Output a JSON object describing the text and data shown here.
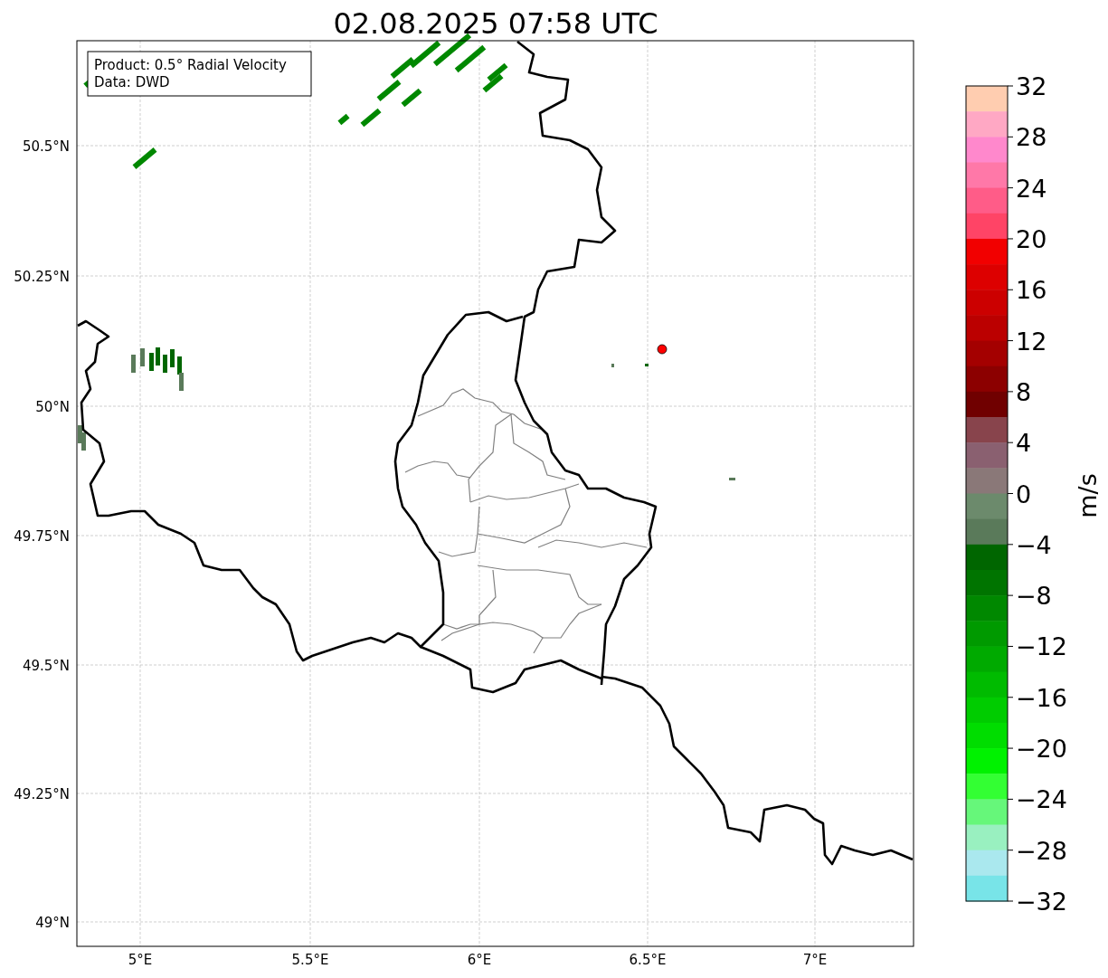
{
  "title": "02.08.2025 07:58 UTC",
  "legend": {
    "lines": [
      "Product: 0.5° Radial Velocity",
      "Data: DWD"
    ]
  },
  "map": {
    "lat_ticks": [
      "50.5°N",
      "50.25°N",
      "50°N",
      "49.75°N",
      "49.5°N",
      "49.25°N",
      "49°N"
    ],
    "lon_ticks": [
      "5°E",
      "5.5°E",
      "6°E",
      "6.5°E",
      "7°E"
    ]
  },
  "colorbar": {
    "label": "m/s",
    "ticks": [
      "32",
      "28",
      "24",
      "20",
      "16",
      "12",
      "8",
      "4",
      "0",
      "−4",
      "−8",
      "−12",
      "−16",
      "−20",
      "−24",
      "−28",
      "−32"
    ],
    "segments": [
      {
        "color": "#ffcdb0"
      },
      {
        "color": "#ffa8c4"
      },
      {
        "color": "#ff88cc"
      },
      {
        "color": "#ff78a8"
      },
      {
        "color": "#ff5c88"
      },
      {
        "color": "#ff4466"
      },
      {
        "color": "#f20000"
      },
      {
        "color": "#dd0000"
      },
      {
        "color": "#cc0000"
      },
      {
        "color": "#bb0000"
      },
      {
        "color": "#a40000"
      },
      {
        "color": "#8c0000"
      },
      {
        "color": "#700000"
      },
      {
        "color": "#88444c"
      },
      {
        "color": "#8a6070"
      },
      {
        "color": "#8a7878"
      },
      {
        "color": "#6c8a6c"
      },
      {
        "color": "#5a7a5a"
      },
      {
        "color": "#006600"
      },
      {
        "color": "#007400"
      },
      {
        "color": "#008800"
      },
      {
        "color": "#009a00"
      },
      {
        "color": "#00aa00"
      },
      {
        "color": "#00bb00"
      },
      {
        "color": "#00cc00"
      },
      {
        "color": "#00dd00"
      },
      {
        "color": "#00f200"
      },
      {
        "color": "#33ff33"
      },
      {
        "color": "#66f77a"
      },
      {
        "color": "#99f0c0"
      },
      {
        "color": "#aae8ee"
      },
      {
        "color": "#78e4e8"
      }
    ]
  }
}
